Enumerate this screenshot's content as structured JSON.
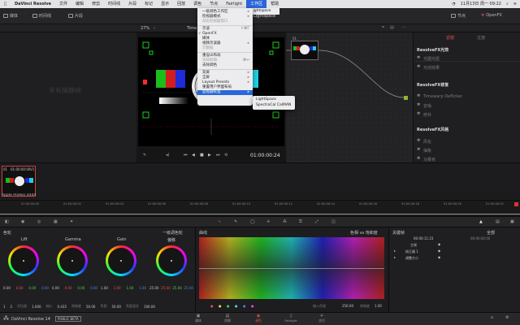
{
  "menubar": {
    "app_name": "DaVinci Resolve",
    "items": [
      "文件",
      "编辑",
      "修剪",
      "时间线",
      "片段",
      "标记",
      "显示",
      "回放",
      "调色",
      "节点",
      "Fairlight",
      "工作区",
      "帮助"
    ],
    "active_index": 11,
    "right_text": "11月13日 周一 09:22"
  },
  "appbar": {
    "media_label": "媒体",
    "timeline_label": "时间线",
    "title": "Lightspace",
    "nodes_label": "节点",
    "openfx_label": "OpenFX",
    "library_label": "片段"
  },
  "toolbar2": {
    "zoom": "27%",
    "fit": "Time",
    "mode_label": "片段"
  },
  "media": {
    "placeholder": "未有捕静帧"
  },
  "viewer": {
    "timecode": "01:00:00:24"
  },
  "dropdown": {
    "items": [
      {
        "label": "一级调色工作区",
        "disabled": false,
        "sub": true
      },
      {
        "label": "检视器模式",
        "disabled": false,
        "sub": true
      },
      {
        "label": "动态检视器窗口",
        "disabled": true
      },
      {
        "sep": true
      },
      {
        "label": "示波",
        "disabled": false,
        "shortcut": "⇧⌘F"
      },
      {
        "label": "OpenFX",
        "disabled": false,
        "checked": true
      },
      {
        "label": "媒体",
        "disabled": false
      },
      {
        "label": "视频示波器",
        "disabled": false,
        "sub": true
      },
      {
        "label": "元数据",
        "disabled": true
      },
      {
        "sep": true
      },
      {
        "label": "重设UI布局",
        "disabled": false
      },
      {
        "label": "去除剪辑",
        "disabled": true,
        "shortcut": "⌘↩"
      },
      {
        "label": "去除调色",
        "disabled": false
      },
      {
        "sep": true
      },
      {
        "label": "双屏",
        "disabled": false,
        "sub": true
      },
      {
        "label": "全屏",
        "disabled": false,
        "sub": true
      },
      {
        "label": "Layout Presets",
        "disabled": false,
        "sub": true
      },
      {
        "label": "重置用户界面布局",
        "disabled": false
      },
      {
        "label": "监视器校准",
        "disabled": false,
        "sub": true,
        "highlight": true
      }
    ],
    "top_submenu": "Lightspace"
  },
  "submenu": {
    "items": [
      "LightSpace",
      "SpectraCal CalMAN"
    ]
  },
  "side_panel": {
    "tabs": [
      "滤镜",
      "过渡"
    ],
    "sections": [
      {
        "title": "ResolveFX光效",
        "items": [
          "光圈光斑",
          "光线效果"
        ]
      },
      {
        "title": "ResolveFX修复",
        "items": [
          "Timewarp Deflicker",
          "去噪",
          "修补"
        ]
      },
      {
        "title": "ResolveFX风格",
        "items": [
          "风化",
          "抽象",
          "马赛克"
        ]
      }
    ]
  },
  "clipstrip": {
    "clip_index": "01",
    "clip_tc": "01:00:00:00",
    "clip_track": "V1",
    "clip_name": "Apple ProRes 4444"
  },
  "ruler": {
    "ticks": [
      "01:00:00:00",
      "01:00:00:02",
      "01:00:00:04",
      "01:00:00:06",
      "01:00:00:08",
      "01:00:00:10",
      "01:00:00:12",
      "01:00:00:14",
      "01:00:00:16",
      "01:00:00:18",
      "01:00:00:20",
      "01:00:00:22"
    ]
  },
  "wheels": {
    "section_title": "色轮",
    "mode": "一级调色轮",
    "items": [
      {
        "name": "Lift",
        "values": [
          "0.00",
          "0.00",
          "0.00",
          "0.00"
        ]
      },
      {
        "name": "Gamma",
        "values": [
          "0.00",
          "0.00",
          "0.00",
          "0.00"
        ]
      },
      {
        "name": "Gain",
        "values": [
          "1.00",
          "1.00",
          "1.00",
          "1.00"
        ]
      },
      {
        "name": "偏移",
        "values": [
          "25.00",
          "25.00",
          "25.00",
          "25.00"
        ]
      }
    ],
    "footer": [
      {
        "label": "对比度",
        "value": "1.000"
      },
      {
        "label": "轴心",
        "value": "0.435"
      },
      {
        "label": "饱和度",
        "value": "50.00"
      },
      {
        "label": "色相",
        "value": "50.00"
      },
      {
        "label": "亮度混合",
        "value": "100.00"
      }
    ]
  },
  "curves": {
    "title": "曲线",
    "mode": "色相 vs 饱和度",
    "input_label": "输入色相",
    "input_value": "256.00",
    "sat_label": "饱和度",
    "sat_value": "1.00"
  },
  "keyframes": {
    "title": "关键帧",
    "all_label": "全部",
    "timecode_a": "00:00:11:23",
    "timecode_b": "00:00:00:00",
    "rows": [
      "主帧",
      "校正器 1",
      "调整大小"
    ]
  },
  "bottombar": {
    "app": "DaVinci Resolve 14",
    "badge": "PUBLIC BETA",
    "tabs": [
      "媒体",
      "剪辑",
      "调色",
      "Fairlight",
      "交付"
    ],
    "active_tab": 2
  }
}
